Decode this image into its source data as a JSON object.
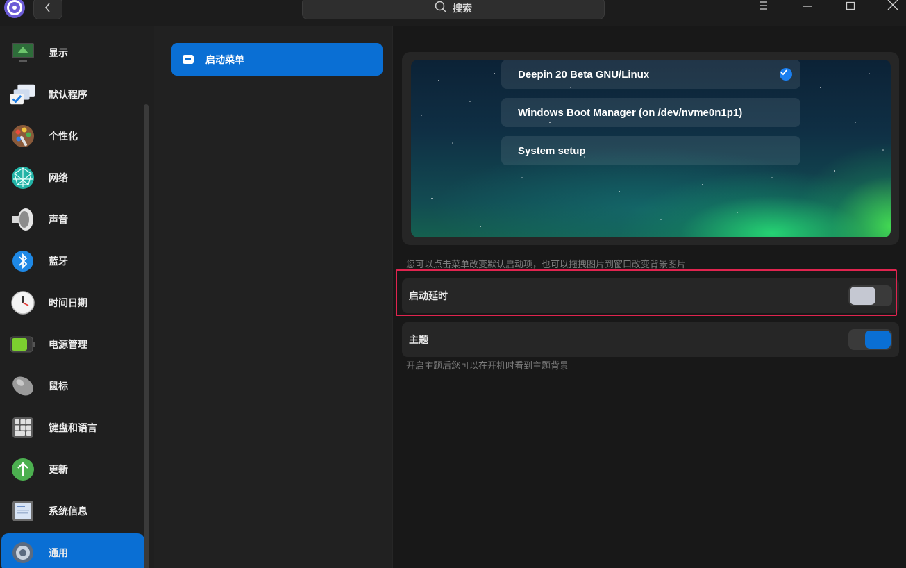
{
  "titlebar": {
    "search_placeholder": "搜索",
    "logo_icon": "gear-flower-logo",
    "back_icon": "chevron-left-icon",
    "menu_icon": "hamburger-icon",
    "minimize_icon": "minimize-icon",
    "maximize_icon": "maximize-icon",
    "close_icon": "close-icon"
  },
  "sidebar": {
    "items": [
      {
        "label": "显示",
        "icon": "display-icon"
      },
      {
        "label": "默认程序",
        "icon": "default-apps-icon"
      },
      {
        "label": "个性化",
        "icon": "personalization-icon"
      },
      {
        "label": "网络",
        "icon": "network-icon"
      },
      {
        "label": "声音",
        "icon": "sound-icon"
      },
      {
        "label": "蓝牙",
        "icon": "bluetooth-icon"
      },
      {
        "label": "时间日期",
        "icon": "clock-icon"
      },
      {
        "label": "电源管理",
        "icon": "battery-icon"
      },
      {
        "label": "鼠标",
        "icon": "mouse-icon"
      },
      {
        "label": "键盘和语言",
        "icon": "keyboard-icon"
      },
      {
        "label": "更新",
        "icon": "update-icon"
      },
      {
        "label": "系统信息",
        "icon": "system-info-icon"
      },
      {
        "label": "通用",
        "icon": "general-gear-icon",
        "active": true
      }
    ]
  },
  "middle": {
    "items": [
      {
        "label": "启动菜单",
        "active": true
      }
    ]
  },
  "main": {
    "boot_entries": [
      {
        "label": "Deepin 20 Beta GNU/Linux",
        "selected": true
      },
      {
        "label": "Windows Boot Manager (on /dev/nvme0n1p1)",
        "selected": false
      },
      {
        "label": "System setup",
        "selected": false
      }
    ],
    "boot_hint": "您可以点击菜单改变默认启动项，也可以拖拽图片到窗口改变背景图片",
    "boot_delay": {
      "label": "启动延时",
      "enabled": false
    },
    "theme": {
      "label": "主题",
      "enabled": true
    },
    "theme_hint": "开启主题后您可以在开机时看到主题背景"
  },
  "colors": {
    "accent": "#0a6fd4",
    "highlight_border": "#e0244f"
  }
}
